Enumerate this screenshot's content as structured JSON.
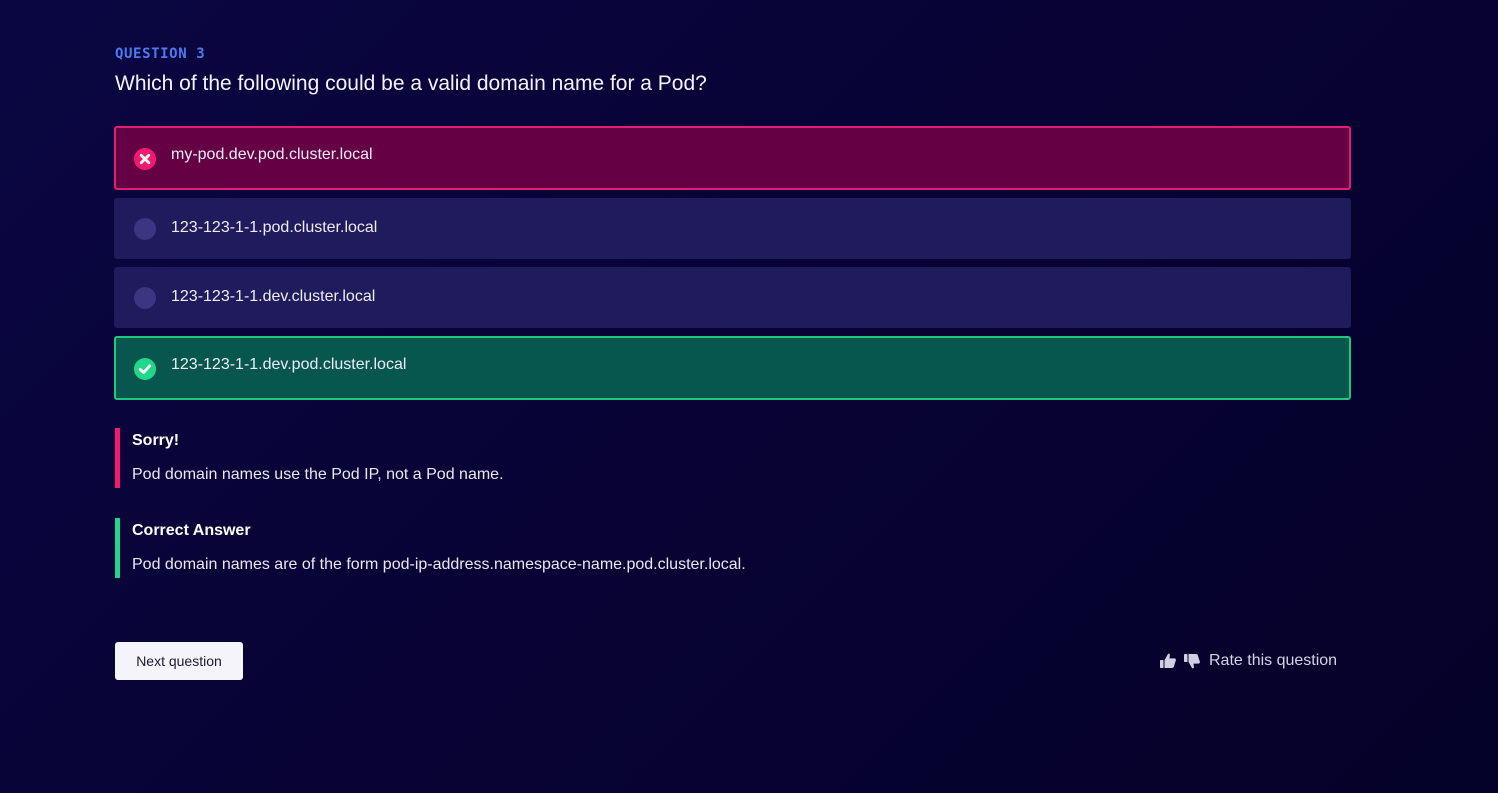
{
  "question": {
    "number_label": "QUESTION 3",
    "text": "Which of the following could be a valid domain name for a Pod?"
  },
  "options": [
    {
      "label": "my-pod.dev.pod.cluster.local",
      "state": "wrong",
      "icon": "x-circle-icon"
    },
    {
      "label": "123-123-1-1.pod.cluster.local",
      "state": "neutral",
      "icon": "radio-circle-icon"
    },
    {
      "label": "123-123-1-1.dev.cluster.local",
      "state": "neutral",
      "icon": "radio-circle-icon"
    },
    {
      "label": "123-123-1-1.dev.pod.cluster.local",
      "state": "correct",
      "icon": "check-circle-icon"
    }
  ],
  "feedback": {
    "sorry_title": "Sorry!",
    "sorry_text": "Pod domain names use the Pod IP, not a Pod name.",
    "answer_title": "Correct Answer",
    "answer_text": "Pod domain names are of the form pod-ip-address.namespace-name.pod.cluster.local."
  },
  "actions": {
    "next_label": "Next question",
    "rate_label": "Rate this question"
  },
  "colors": {
    "accent_blue": "#4a7cf0",
    "wrong": "#f3196f",
    "correct": "#22d789",
    "background": "#080335"
  }
}
